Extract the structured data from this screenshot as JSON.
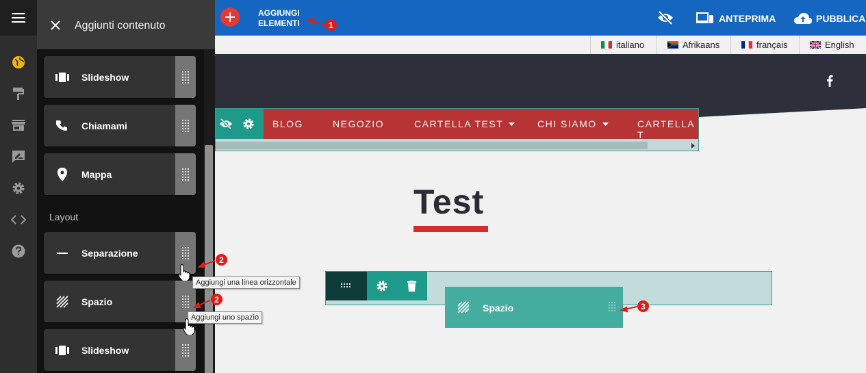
{
  "panel": {
    "title": "Aggiunti contenuto",
    "section_layout": "Layout",
    "cards": [
      {
        "label": "Slideshow"
      },
      {
        "label": "Chiamami"
      },
      {
        "label": "Mappa"
      },
      {
        "label": "Separazione"
      },
      {
        "label": "Spazio"
      },
      {
        "label": "Slideshow"
      }
    ]
  },
  "topbar": {
    "add_label_line1": "AGGIUNGI",
    "add_label_line2": "ELEMENTI",
    "preview_label": "ANTEPRIMA",
    "publish_label": "PUBBLICA"
  },
  "languages": [
    {
      "label": "italiano"
    },
    {
      "label": "Afrikaans"
    },
    {
      "label": "français"
    },
    {
      "label": "English"
    }
  ],
  "nav": {
    "items": [
      "BLOG",
      "NEGOZIO",
      "CARTELLA TEST",
      "CHI SIAMO",
      "CARTELLA T"
    ]
  },
  "main": {
    "title": "Test",
    "drag_item_label": "Spazio"
  },
  "tooltips": {
    "separator": "Aggiungi una linea orizzontale",
    "space": "Aggiungi uno spazio"
  },
  "markers": [
    "1",
    "2",
    "2",
    "3"
  ],
  "colors": {
    "topbar": "#1566c0",
    "add_button": "#e53935",
    "nav_bar": "#b83434",
    "teal": "#1d9a8a",
    "accent_red": "#d62c2c"
  }
}
